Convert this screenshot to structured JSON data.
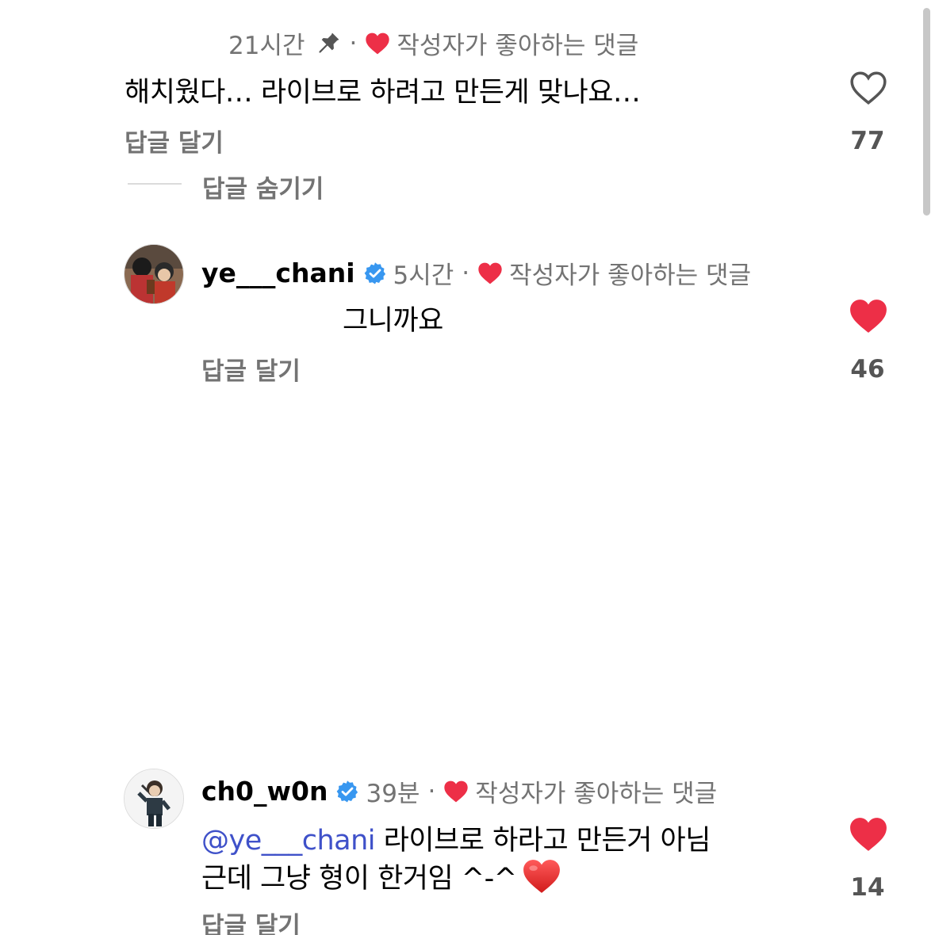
{
  "comments": [
    {
      "time": "21시간",
      "creator_liked": "작성자가 좋아하는 댓글",
      "text": "해치웠다… 라이브로 하려고 만든게 맞나요…",
      "reply": "답글 달기",
      "likes": "77",
      "hide_replies": "답글 숨기기"
    },
    {
      "username": "ye___chani",
      "time": "5시간",
      "creator_liked": "작성자가 좋아하는 댓글",
      "text": "그니까요",
      "reply": "답글 달기",
      "likes": "46"
    },
    {
      "username": "ch0_w0n",
      "time": "39분",
      "creator_liked": "작성자가 좋아하는 댓글",
      "mention": "@ye___chani",
      "text_line1": " 라이브로 하라고 만든거 아님",
      "text_line2": "근데 그냥 형이 한거임 ^-^",
      "reply": "답글 달기",
      "likes": "14"
    }
  ],
  "colors": {
    "heart_red": "#ed2f47",
    "secondary_text": "#737373",
    "mention_blue": "#3f51c9",
    "verified_blue": "#3897f0"
  },
  "icons": [
    "pin-icon",
    "heart-filled-icon",
    "heart-outline-icon",
    "verified-badge-icon",
    "red-heart-emoji-icon"
  ]
}
